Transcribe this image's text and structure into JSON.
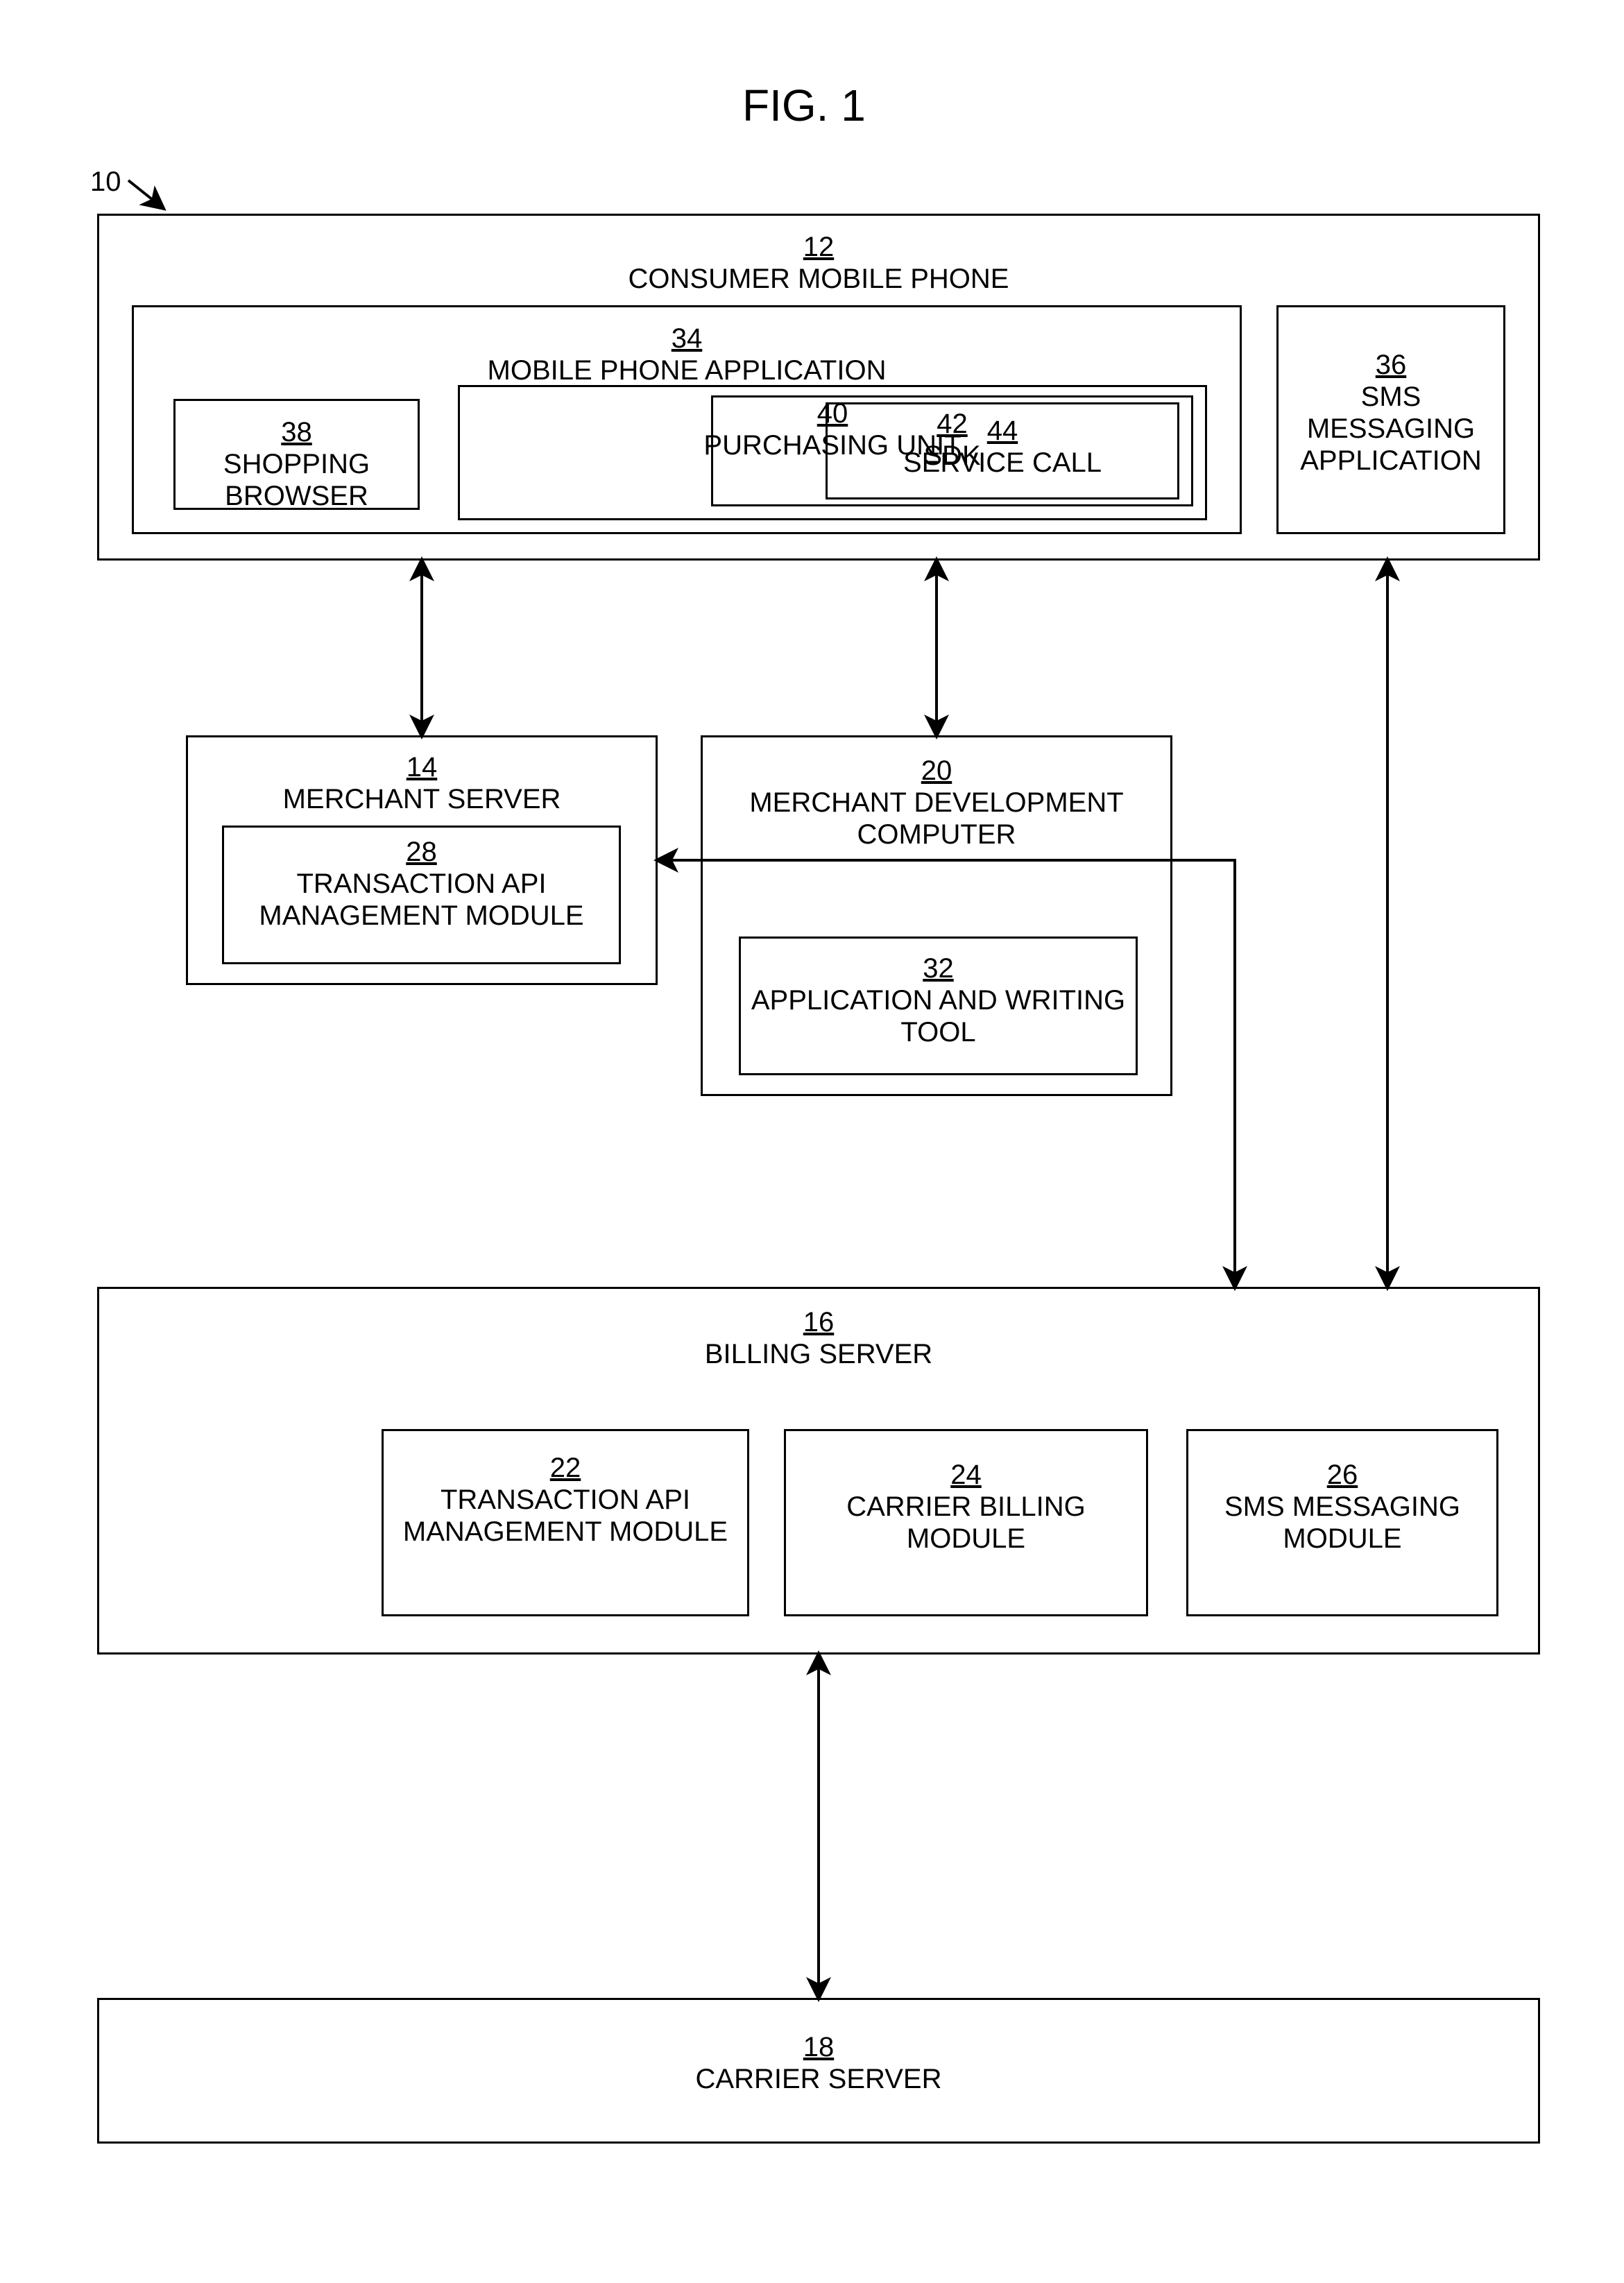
{
  "figure": {
    "title": "FIG. 1",
    "ref": "10"
  },
  "boxes": {
    "consumer_phone": {
      "num": "12",
      "label": "CONSUMER MOBILE PHONE"
    },
    "mobile_app": {
      "num": "34",
      "label": "MOBILE PHONE APPLICATION"
    },
    "shopping_browser": {
      "num": "38",
      "label": "SHOPPING BROWSER"
    },
    "purchasing_unit": {
      "num": "40",
      "label": "PURCHASING UNIT"
    },
    "sdk": {
      "num": "42",
      "label": "SDK"
    },
    "service_call": {
      "num": "44",
      "label": "SERVICE CALL"
    },
    "sms_app": {
      "num": "36",
      "label": "SMS MESSAGING APPLICATION"
    },
    "merchant_server": {
      "num": "14",
      "label": "MERCHANT SERVER"
    },
    "trans_api_28": {
      "num": "28",
      "label": "TRANSACTION API MANAGEMENT MODULE"
    },
    "merchant_dev": {
      "num": "20",
      "label": "MERCHANT DEVELOPMENT COMPUTER"
    },
    "app_writing_tool": {
      "num": "32",
      "label": "APPLICATION AND WRITING TOOL"
    },
    "billing_server": {
      "num": "16",
      "label": "BILLING SERVER"
    },
    "trans_api_22": {
      "num": "22",
      "label": "TRANSACTION API MANAGEMENT MODULE"
    },
    "carrier_billing": {
      "num": "24",
      "label": "CARRIER BILLING MODULE"
    },
    "sms_messaging_mod": {
      "num": "26",
      "label": "SMS MESSAGING MODULE"
    },
    "carrier_server": {
      "num": "18",
      "label": "CARRIER SERVER"
    }
  }
}
